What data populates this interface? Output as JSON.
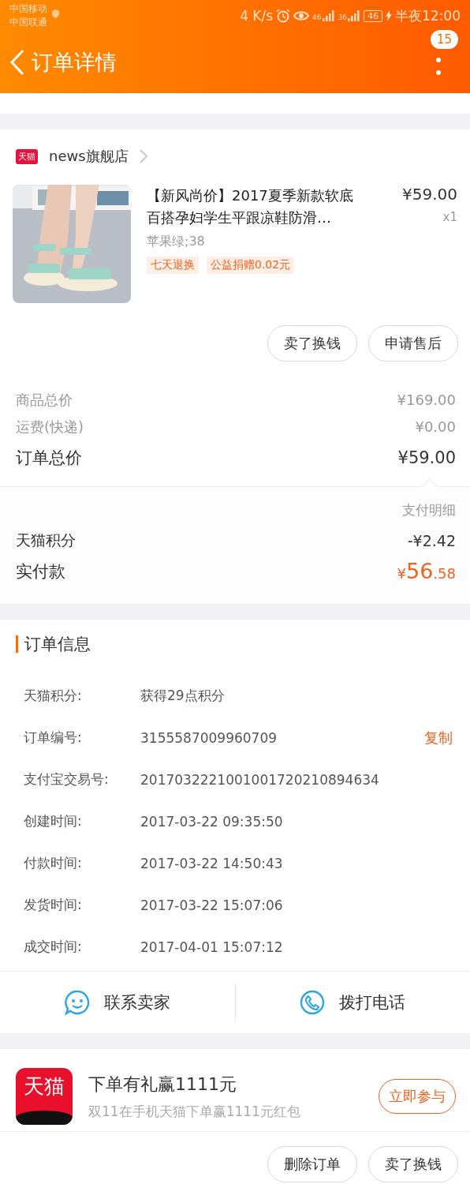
{
  "status_bar": {
    "carriers": [
      "中国移动",
      "中国联通"
    ],
    "speed": "4 K/s",
    "network_1": "46",
    "network_2": "36",
    "battery": "46",
    "time": "半夜12:00"
  },
  "header": {
    "title": "订单详情",
    "badge": "15"
  },
  "store": {
    "logo": "天猫",
    "name": "news旗舰店"
  },
  "product": {
    "kind": "picture",
    "title": "【新风尚价】2017夏季新款软底百搭孕妇学生平跟凉鞋防滑…",
    "price": "¥59.00",
    "quantity": "x1",
    "sku": "苹果绿;38",
    "tags": [
      "七天退换",
      "公益捐赠0.02元"
    ]
  },
  "item_actions": [
    "卖了换钱",
    "申请售后"
  ],
  "prices": [
    {
      "label": "商品总价",
      "value": "¥169.00",
      "kind": "minor"
    },
    {
      "label": "运费(快递)",
      "value": "¥0.00",
      "kind": "minor"
    },
    {
      "label": "订单总价",
      "value": "¥59.00",
      "kind": "total"
    }
  ],
  "payment": {
    "heading": "支付明细",
    "rows": [
      {
        "label": "天猫积分",
        "value": "-¥2.42"
      }
    ],
    "paid": {
      "label": "实付款",
      "currency": "¥",
      "integer": "56",
      "decimal": ".58"
    }
  },
  "order_info": {
    "title": "订单信息",
    "rows": [
      {
        "label": "天猫积分:",
        "value": "获得29点积分"
      },
      {
        "label": "订单编号:",
        "value": "3155587009960709",
        "action": "复制"
      },
      {
        "label": "支付宝交易号:",
        "value": "2017032221001001720210894634"
      },
      {
        "label": "创建时间:",
        "value": "2017-03-22 09:35:50"
      },
      {
        "label": "付款时间:",
        "value": "2017-03-22 14:50:43"
      },
      {
        "label": "发货时间:",
        "value": "2017-03-22 15:07:06"
      },
      {
        "label": "成交时间:",
        "value": "2017-04-01 15:07:12"
      }
    ]
  },
  "contact": [
    {
      "label": "联系卖家",
      "kind": "chat"
    },
    {
      "label": "拨打电话",
      "kind": "phone"
    }
  ],
  "promo": {
    "logo": "天猫",
    "title": "下单有礼赢1111元",
    "subtitle": "双11在手机天猫下单赢1111元红包",
    "button": "立即参与"
  },
  "bottom_actions": [
    "删除订单",
    "卖了换钱"
  ]
}
